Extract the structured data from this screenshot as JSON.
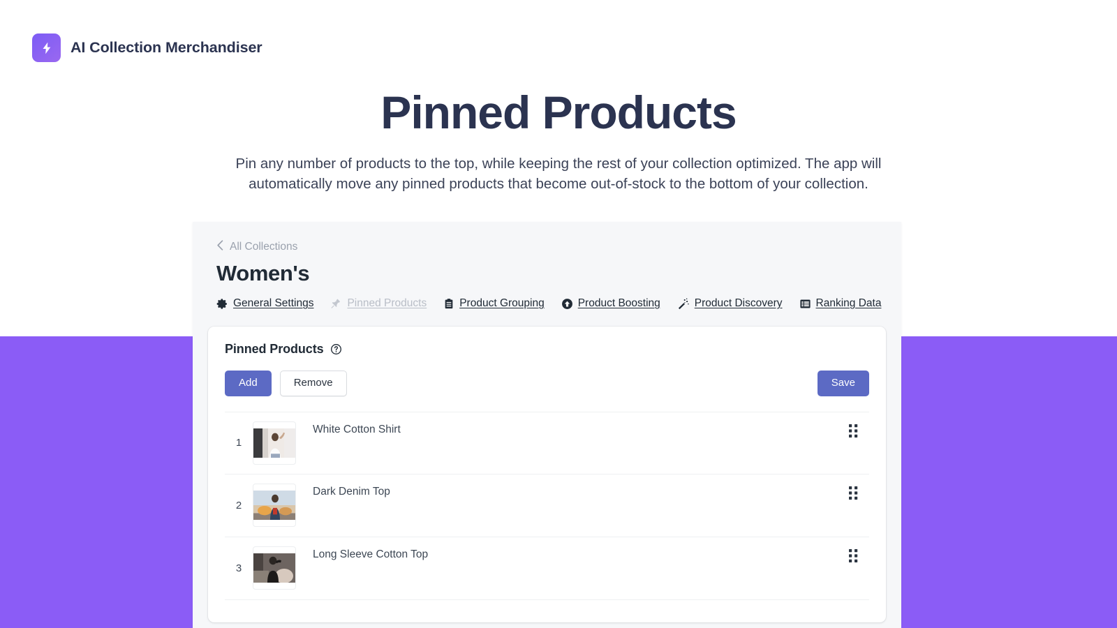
{
  "brand": {
    "name": "AI Collection Merchandiser",
    "icon": "lightning-bolt-icon",
    "mark_color": "#7c5cf5"
  },
  "hero": {
    "title": "Pinned Products",
    "subtitle": "Pin any number of products to the top, while keeping the rest of your collection optimized. The app will automatically move any pinned products that become out-of-stock to the bottom of your collection.",
    "title_color": "#2b3350"
  },
  "theme": {
    "band_color": "#8b5cf6",
    "primary_button_color": "#5c6ac4",
    "panel_bg": "#f6f7f9"
  },
  "app": {
    "breadcrumb": {
      "icon": "chevron-left-icon",
      "label": "All Collections"
    },
    "collection_title": "Women's",
    "tabs": [
      {
        "label": "General Settings",
        "icon": "gear-icon",
        "active": false
      },
      {
        "label": "Pinned Products",
        "icon": "pushpin-icon",
        "active": true
      },
      {
        "label": "Product Grouping",
        "icon": "clipboard-icon",
        "active": false
      },
      {
        "label": "Product Boosting",
        "icon": "arrow-up-circle-icon",
        "active": false
      },
      {
        "label": "Product Discovery",
        "icon": "magic-wand-icon",
        "active": false
      },
      {
        "label": "Ranking Data",
        "icon": "table-list-icon",
        "active": false
      }
    ],
    "card": {
      "title": "Pinned Products",
      "help_icon": "question-circle-icon",
      "buttons": {
        "add": "Add",
        "remove": "Remove",
        "save": "Save"
      },
      "products": [
        {
          "index": "1",
          "title": "White Cotton Shirt",
          "handle_icon": "drag-handle-icon"
        },
        {
          "index": "2",
          "title": "Dark Denim Top",
          "handle_icon": "drag-handle-icon"
        },
        {
          "index": "3",
          "title": "Long Sleeve Cotton Top",
          "handle_icon": "drag-handle-icon"
        }
      ]
    }
  }
}
